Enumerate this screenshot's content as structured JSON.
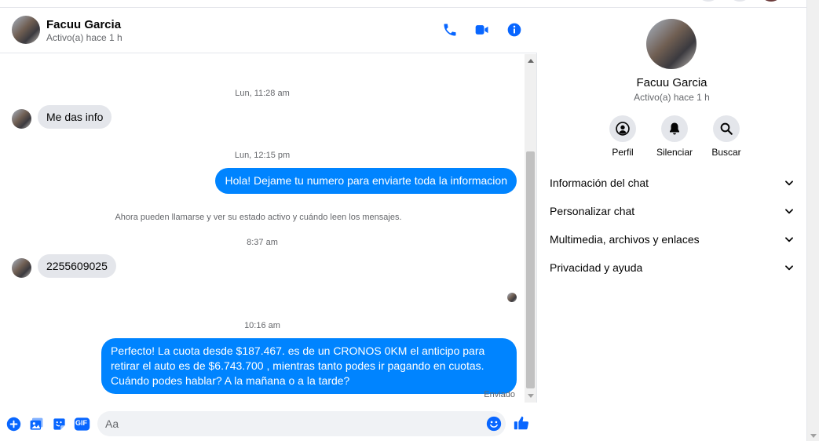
{
  "contact": {
    "name": "Facuu Garcia",
    "status": "Activo(a) hace 1 h"
  },
  "header_icons": [
    "phone-icon",
    "video-camera-icon",
    "info-icon"
  ],
  "messages": [
    {
      "type": "timestamp",
      "text": "Lun, 11:28 am"
    },
    {
      "type": "incoming",
      "text": "Me das info"
    },
    {
      "type": "timestamp",
      "text": "Lun, 12:15 pm"
    },
    {
      "type": "outgoing",
      "text": "Hola! Dejame tu numero  para enviarte toda la informacion"
    },
    {
      "type": "system",
      "text": "Ahora pueden llamarse y ver su estado activo y cuándo leen los mensajes."
    },
    {
      "type": "timestamp",
      "text": "8:37 am"
    },
    {
      "type": "incoming",
      "text": "2255609025"
    },
    {
      "type": "timestamp",
      "text": "10:16 am"
    },
    {
      "type": "outgoing",
      "text": "Perfecto! La cuota desde $187.467. es de un CRONOS 0KM el anticipo para retirar el auto es de $6.743.700 , mientras tanto podes ir pagando en cuotas. Cuándo podes hablar? A la mañana o a la tarde?"
    }
  ],
  "delivery_status": "Enviado",
  "composer": {
    "placeholder": "Aa",
    "icons": [
      "plus-icon",
      "photo-icon",
      "sticker-icon",
      "gif-icon"
    ],
    "gif_label": "GIF"
  },
  "info_panel": {
    "actions": [
      {
        "label": "Perfil",
        "icon": "profile-icon"
      },
      {
        "label": "Silenciar",
        "icon": "bell-icon"
      },
      {
        "label": "Buscar",
        "icon": "search-icon"
      }
    ],
    "sections": [
      {
        "label": "Información del chat"
      },
      {
        "label": "Personalizar chat"
      },
      {
        "label": "Multimedia, archivos y enlaces"
      },
      {
        "label": "Privacidad y ayuda"
      }
    ]
  },
  "colors": {
    "accent": "#0084ff",
    "incoming_bubble": "#e4e6eb",
    "icon_blue": "#0866ff"
  }
}
